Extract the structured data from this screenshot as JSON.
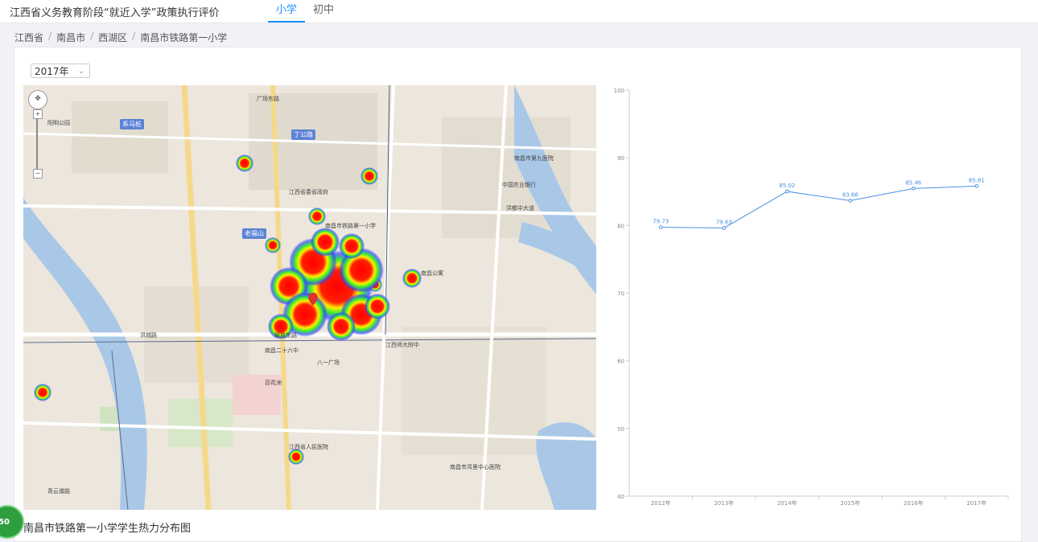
{
  "app": {
    "title": "江西省义务教育阶段“就近入学”政策执行评价"
  },
  "tabs": [
    {
      "label": "小学",
      "active": true
    },
    {
      "label": "初中",
      "active": false
    }
  ],
  "breadcrumb": [
    "江西省",
    "南昌市",
    "西湖区",
    "南昌市铁路第一小学"
  ],
  "filter": {
    "year": "2017年"
  },
  "map": {
    "caption": "南昌市铁路第一小学学生热力分布图",
    "zoom_in": "+",
    "zoom_out": "−",
    "badges": [
      "系马桩",
      "丁公路",
      "老福山"
    ],
    "labels": [
      "江西省委省政府",
      "南昌市铁路第一小学",
      "洪城路",
      "解放东路",
      "广场东路",
      "洪都中大道",
      "中国农业银行",
      "南昌市第九医院",
      "南昌公寓",
      "八一广场",
      "江西师大附中",
      "南昌二十六中",
      "阳明公园",
      "百花洲",
      "南昌市湾里中心医院",
      "青云谱路",
      "江西省人民医院"
    ]
  },
  "chart_data": {
    "type": "line",
    "categories": [
      "2012年",
      "2013年",
      "2014年",
      "2015年",
      "2016年",
      "2017年"
    ],
    "values": [
      79.73,
      79.63,
      85.02,
      83.66,
      85.46,
      85.81
    ],
    "ylim": [
      40,
      100
    ],
    "yticks": [
      40,
      50,
      60,
      70,
      80,
      90,
      100
    ],
    "color": "#4a90e2",
    "grid": false
  },
  "floating": {
    "badge": "50"
  }
}
